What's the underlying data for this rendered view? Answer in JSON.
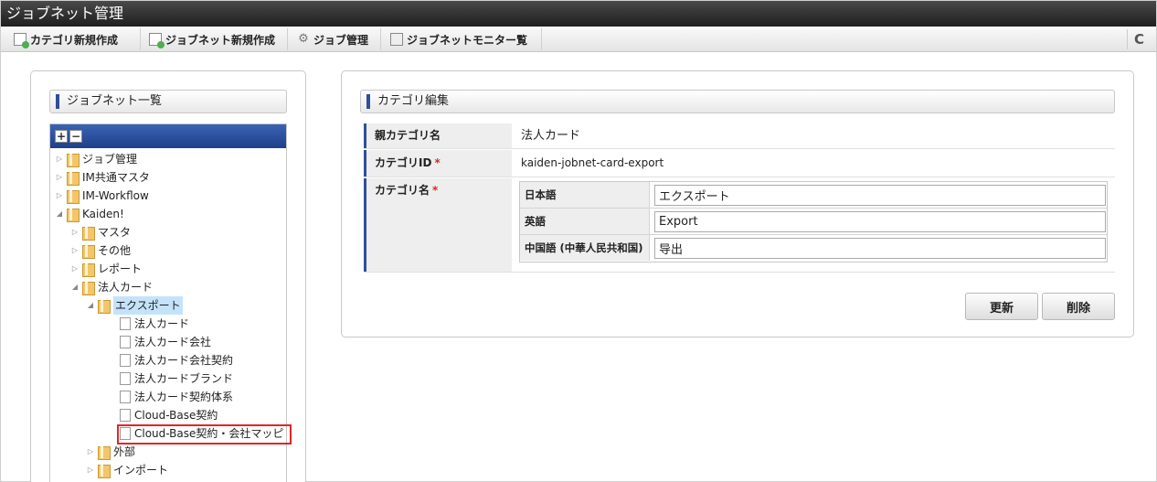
{
  "app": {
    "title": "ジョブネット管理"
  },
  "toolbar": {
    "new_category": "カテゴリ新規作成",
    "new_jobnet": "ジョブネット新規作成",
    "job_management": "ジョブ管理",
    "jobnet_monitor": "ジョブネットモニター覧",
    "refresh_icon": "C"
  },
  "left": {
    "header": "ジョブネット一覧",
    "expand_all": "+",
    "collapse_all": "−",
    "tree": [
      {
        "label": "ジョブ管理",
        "level": 0,
        "expanded": false,
        "type": "folder"
      },
      {
        "label": "IM共通マスタ",
        "level": 0,
        "expanded": false,
        "type": "folder"
      },
      {
        "label": "IM-Workflow",
        "level": 0,
        "expanded": false,
        "type": "folder"
      },
      {
        "label": "Kaiden!",
        "level": 0,
        "expanded": true,
        "type": "folder"
      },
      {
        "label": "マスタ",
        "level": 1,
        "expanded": false,
        "type": "folder"
      },
      {
        "label": "その他",
        "level": 1,
        "expanded": false,
        "type": "folder"
      },
      {
        "label": "レポート",
        "level": 1,
        "expanded": false,
        "type": "folder"
      },
      {
        "label": "法人カード",
        "level": 1,
        "expanded": true,
        "type": "folder"
      },
      {
        "label": "エクスポート",
        "level": 2,
        "expanded": true,
        "type": "folder",
        "selected": true
      },
      {
        "label": "法人カード",
        "level": 3,
        "type": "doc"
      },
      {
        "label": "法人カード会社",
        "level": 3,
        "type": "doc"
      },
      {
        "label": "法人カード会社契約",
        "level": 3,
        "type": "doc"
      },
      {
        "label": "法人カードブランド",
        "level": 3,
        "type": "doc"
      },
      {
        "label": "法人カード契約体系",
        "level": 3,
        "type": "doc"
      },
      {
        "label": "Cloud-Base契約",
        "level": 3,
        "type": "doc"
      },
      {
        "label": "Cloud-Base契約・会社マッピ",
        "level": 3,
        "type": "doc"
      },
      {
        "label": "外部",
        "level": 2,
        "expanded": false,
        "type": "folder"
      },
      {
        "label": "インポート",
        "level": 2,
        "expanded": false,
        "type": "folder"
      }
    ]
  },
  "right": {
    "header": "カテゴリ編集",
    "parent_category_label": "親カテゴリ名",
    "parent_category_value": "法人カード",
    "category_id_label": "カテゴリID",
    "category_id_value": "kaiden-jobnet-card-export",
    "category_name_label": "カテゴリ名",
    "required_mark": "*",
    "languages": [
      {
        "label": "日本語",
        "value": "エクスポート"
      },
      {
        "label": "英語",
        "value": "Export"
      },
      {
        "label": "中国語 (中華人民共和国)",
        "value": "导出"
      }
    ],
    "update_button": "更新",
    "delete_button": "削除"
  }
}
